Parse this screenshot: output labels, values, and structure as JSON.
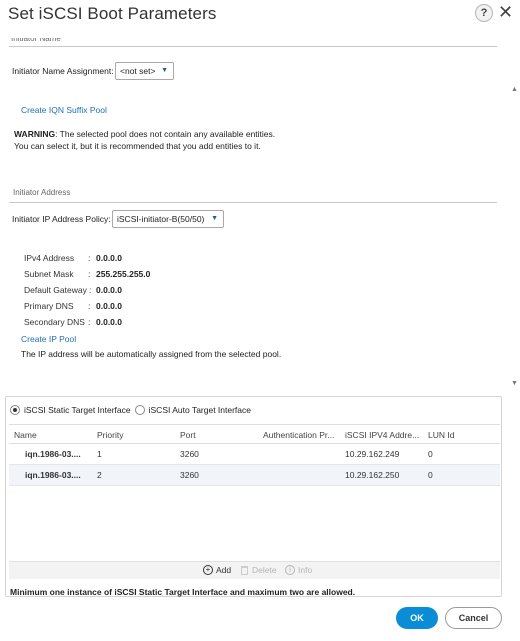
{
  "dialog": {
    "title": "Set iSCSI Boot Parameters",
    "help_label": "?",
    "close_label": "✕"
  },
  "initiator_name": {
    "section_label": "Initiator Name",
    "assignment_label": "Initiator Name Assignment:",
    "assignment_value": "<not set>",
    "create_link": "Create IQN Suffix Pool",
    "warning_bold": "WARNING",
    "warning_line1": ": The selected pool does not contain any available entities.",
    "warning_line2": "You can select it, but it is recommended that you add entities to it."
  },
  "initiator_address": {
    "section_label": "Initiator Address",
    "policy_label": "Initiator IP Address Policy:",
    "policy_value": "iSCSI-initiator-B(50/50)",
    "fields": [
      {
        "key": "IPv4 Address",
        "value": "0.0.0.0"
      },
      {
        "key": "Subnet Mask",
        "value": "255.255.255.0"
      },
      {
        "key": "Default Gateway",
        "value": "0.0.0.0"
      },
      {
        "key": "Primary DNS",
        "value": "0.0.0.0"
      },
      {
        "key": "Secondary DNS",
        "value": "0.0.0.0"
      }
    ],
    "create_link": "Create IP Pool",
    "note": "The IP address will be automatically assigned from the selected pool."
  },
  "target": {
    "static_label": "iSCSI Static Target Interface",
    "auto_label": "iSCSI Auto Target Interface",
    "selected": "static",
    "columns": [
      "Name",
      "Priority",
      "Port",
      "Authentication Pr...",
      "iSCSI IPV4 Addre...",
      "LUN Id"
    ],
    "rows": [
      {
        "name": "iqn.1986-03....",
        "priority": "1",
        "port": "3260",
        "auth": "",
        "ip": "10.29.162.249",
        "lun": "0"
      },
      {
        "name": "iqn.1986-03....",
        "priority": "2",
        "port": "3260",
        "auth": "",
        "ip": "10.29.162.250",
        "lun": "0"
      }
    ],
    "toolbar": {
      "add_label": "Add",
      "delete_label": "Delete",
      "info_label": "Info"
    },
    "footnote": "Minimum one instance of iSCSI Static Target Interface and maximum two are allowed."
  },
  "buttons": {
    "ok": "OK",
    "cancel": "Cancel"
  },
  "colors": {
    "primary": "#0a8dd6",
    "link": "#1f6fb2"
  }
}
